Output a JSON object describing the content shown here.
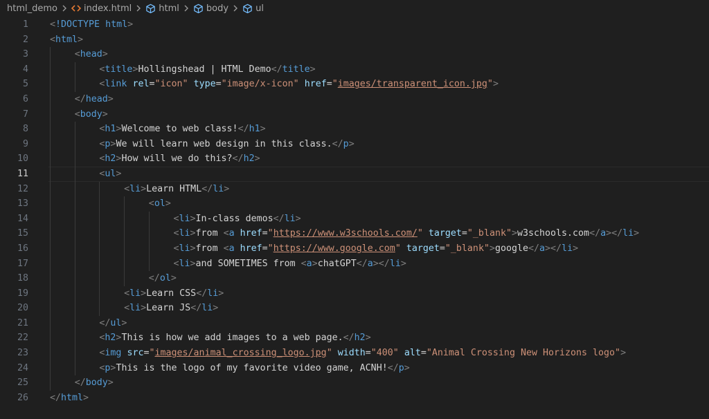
{
  "breadcrumb": {
    "items": [
      {
        "label": "html_demo",
        "icon": "none"
      },
      {
        "label": "index.html",
        "icon": "html-file-icon"
      },
      {
        "label": "html",
        "icon": "symbol-element-icon"
      },
      {
        "label": "body",
        "icon": "symbol-element-icon"
      },
      {
        "label": "ul",
        "icon": "symbol-element-icon"
      }
    ]
  },
  "editor": {
    "current_line": 11,
    "colors": {
      "background": "#1f1f1f",
      "tag": "#569cd6",
      "bracket": "#808080",
      "attribute": "#9cdcfe",
      "string": "#ce9178",
      "text": "#d4d4d4",
      "line_number": "#6e7681"
    },
    "lines": [
      {
        "n": "1",
        "indent": 0,
        "tokens": [
          [
            "p",
            "<"
          ],
          [
            "tag",
            "!DOCTYPE html"
          ],
          [
            "p",
            ">"
          ]
        ]
      },
      {
        "n": "2",
        "indent": 0,
        "tokens": [
          [
            "p",
            "<"
          ],
          [
            "tag",
            "html"
          ],
          [
            "p",
            ">"
          ]
        ]
      },
      {
        "n": "3",
        "indent": 1,
        "tokens": [
          [
            "p",
            "<"
          ],
          [
            "tag",
            "head"
          ],
          [
            "p",
            ">"
          ]
        ]
      },
      {
        "n": "4",
        "indent": 2,
        "tokens": [
          [
            "p",
            "<"
          ],
          [
            "tag",
            "title"
          ],
          [
            "p",
            ">"
          ],
          [
            "txt",
            "Hollingshead | HTML Demo"
          ],
          [
            "p",
            "</"
          ],
          [
            "tag",
            "title"
          ],
          [
            "p",
            ">"
          ]
        ]
      },
      {
        "n": "5",
        "indent": 2,
        "tokens": [
          [
            "p",
            "<"
          ],
          [
            "tag",
            "link"
          ],
          [
            "txt",
            " "
          ],
          [
            "attr",
            "rel"
          ],
          [
            "txt",
            "="
          ],
          [
            "val",
            "\"icon\""
          ],
          [
            "txt",
            " "
          ],
          [
            "attr",
            "type"
          ],
          [
            "txt",
            "="
          ],
          [
            "val",
            "\"image/x-icon\""
          ],
          [
            "txt",
            " "
          ],
          [
            "attr",
            "href"
          ],
          [
            "txt",
            "="
          ],
          [
            "val",
            "\""
          ],
          [
            "url",
            "images/transparent_icon.jpg"
          ],
          [
            "val",
            "\""
          ],
          [
            "p",
            ">"
          ]
        ]
      },
      {
        "n": "6",
        "indent": 1,
        "tokens": [
          [
            "p",
            "</"
          ],
          [
            "tag",
            "head"
          ],
          [
            "p",
            ">"
          ]
        ]
      },
      {
        "n": "7",
        "indent": 1,
        "tokens": [
          [
            "p",
            "<"
          ],
          [
            "tag",
            "body"
          ],
          [
            "p",
            ">"
          ]
        ]
      },
      {
        "n": "8",
        "indent": 2,
        "tokens": [
          [
            "p",
            "<"
          ],
          [
            "tag",
            "h1"
          ],
          [
            "p",
            ">"
          ],
          [
            "txt",
            "Welcome to web class!"
          ],
          [
            "p",
            "</"
          ],
          [
            "tag",
            "h1"
          ],
          [
            "p",
            ">"
          ]
        ]
      },
      {
        "n": "9",
        "indent": 2,
        "tokens": [
          [
            "p",
            "<"
          ],
          [
            "tag",
            "p"
          ],
          [
            "p",
            ">"
          ],
          [
            "txt",
            "We will learn web design in this class."
          ],
          [
            "p",
            "</"
          ],
          [
            "tag",
            "p"
          ],
          [
            "p",
            ">"
          ]
        ]
      },
      {
        "n": "10",
        "indent": 2,
        "tokens": [
          [
            "p",
            "<"
          ],
          [
            "tag",
            "h2"
          ],
          [
            "p",
            ">"
          ],
          [
            "txt",
            "How will we do this?"
          ],
          [
            "p",
            "</"
          ],
          [
            "tag",
            "h2"
          ],
          [
            "p",
            ">"
          ]
        ]
      },
      {
        "n": "11",
        "indent": 2,
        "tokens": [
          [
            "p",
            "<"
          ],
          [
            "tag",
            "ul"
          ],
          [
            "p",
            ">"
          ]
        ]
      },
      {
        "n": "12",
        "indent": 3,
        "tokens": [
          [
            "p",
            "<"
          ],
          [
            "tag",
            "li"
          ],
          [
            "p",
            ">"
          ],
          [
            "txt",
            "Learn HTML"
          ],
          [
            "p",
            "</"
          ],
          [
            "tag",
            "li"
          ],
          [
            "p",
            ">"
          ]
        ]
      },
      {
        "n": "13",
        "indent": 4,
        "tokens": [
          [
            "p",
            "<"
          ],
          [
            "tag",
            "ol"
          ],
          [
            "p",
            ">"
          ]
        ]
      },
      {
        "n": "14",
        "indent": 5,
        "tokens": [
          [
            "p",
            "<"
          ],
          [
            "tag",
            "li"
          ],
          [
            "p",
            ">"
          ],
          [
            "txt",
            "In-class demos"
          ],
          [
            "p",
            "</"
          ],
          [
            "tag",
            "li"
          ],
          [
            "p",
            ">"
          ]
        ]
      },
      {
        "n": "15",
        "indent": 5,
        "tokens": [
          [
            "p",
            "<"
          ],
          [
            "tag",
            "li"
          ],
          [
            "p",
            ">"
          ],
          [
            "txt",
            "from "
          ],
          [
            "p",
            "<"
          ],
          [
            "tag",
            "a"
          ],
          [
            "txt",
            " "
          ],
          [
            "attr",
            "href"
          ],
          [
            "txt",
            "="
          ],
          [
            "val",
            "\""
          ],
          [
            "url",
            "https://www.w3schools.com/"
          ],
          [
            "val",
            "\""
          ],
          [
            "txt",
            " "
          ],
          [
            "attr",
            "target"
          ],
          [
            "txt",
            "="
          ],
          [
            "val",
            "\"_blank\""
          ],
          [
            "p",
            ">"
          ],
          [
            "txt",
            "w3schools.com"
          ],
          [
            "p",
            "</"
          ],
          [
            "tag",
            "a"
          ],
          [
            "p",
            "></"
          ],
          [
            "tag",
            "li"
          ],
          [
            "p",
            ">"
          ]
        ]
      },
      {
        "n": "16",
        "indent": 5,
        "tokens": [
          [
            "p",
            "<"
          ],
          [
            "tag",
            "li"
          ],
          [
            "p",
            ">"
          ],
          [
            "txt",
            "from "
          ],
          [
            "p",
            "<"
          ],
          [
            "tag",
            "a"
          ],
          [
            "txt",
            " "
          ],
          [
            "attr",
            "href"
          ],
          [
            "txt",
            "="
          ],
          [
            "val",
            "\""
          ],
          [
            "url",
            "https://www.google.com"
          ],
          [
            "val",
            "\""
          ],
          [
            "txt",
            " "
          ],
          [
            "attr",
            "target"
          ],
          [
            "txt",
            "="
          ],
          [
            "val",
            "\"_blank\""
          ],
          [
            "p",
            ">"
          ],
          [
            "txt",
            "google"
          ],
          [
            "p",
            "</"
          ],
          [
            "tag",
            "a"
          ],
          [
            "p",
            "></"
          ],
          [
            "tag",
            "li"
          ],
          [
            "p",
            ">"
          ]
        ]
      },
      {
        "n": "17",
        "indent": 5,
        "tokens": [
          [
            "p",
            "<"
          ],
          [
            "tag",
            "li"
          ],
          [
            "p",
            ">"
          ],
          [
            "txt",
            "and SOMETIMES from "
          ],
          [
            "p",
            "<"
          ],
          [
            "tag",
            "a"
          ],
          [
            "p",
            ">"
          ],
          [
            "txt",
            "chatGPT"
          ],
          [
            "p",
            "</"
          ],
          [
            "tag",
            "a"
          ],
          [
            "p",
            "></"
          ],
          [
            "tag",
            "li"
          ],
          [
            "p",
            ">"
          ]
        ]
      },
      {
        "n": "18",
        "indent": 4,
        "tokens": [
          [
            "p",
            "</"
          ],
          [
            "tag",
            "ol"
          ],
          [
            "p",
            ">"
          ]
        ]
      },
      {
        "n": "19",
        "indent": 3,
        "tokens": [
          [
            "p",
            "<"
          ],
          [
            "tag",
            "li"
          ],
          [
            "p",
            ">"
          ],
          [
            "txt",
            "Learn CSS"
          ],
          [
            "p",
            "</"
          ],
          [
            "tag",
            "li"
          ],
          [
            "p",
            ">"
          ]
        ]
      },
      {
        "n": "20",
        "indent": 3,
        "tokens": [
          [
            "p",
            "<"
          ],
          [
            "tag",
            "li"
          ],
          [
            "p",
            ">"
          ],
          [
            "txt",
            "Learn JS"
          ],
          [
            "p",
            "</"
          ],
          [
            "tag",
            "li"
          ],
          [
            "p",
            ">"
          ]
        ]
      },
      {
        "n": "21",
        "indent": 2,
        "tokens": [
          [
            "p",
            "</"
          ],
          [
            "tag",
            "ul"
          ],
          [
            "p",
            ">"
          ]
        ]
      },
      {
        "n": "22",
        "indent": 2,
        "tokens": [
          [
            "p",
            "<"
          ],
          [
            "tag",
            "h2"
          ],
          [
            "p",
            ">"
          ],
          [
            "txt",
            "This is how we add images to a web page."
          ],
          [
            "p",
            "</"
          ],
          [
            "tag",
            "h2"
          ],
          [
            "p",
            ">"
          ]
        ]
      },
      {
        "n": "23",
        "indent": 2,
        "tokens": [
          [
            "p",
            "<"
          ],
          [
            "tag",
            "img"
          ],
          [
            "txt",
            " "
          ],
          [
            "attr",
            "src"
          ],
          [
            "txt",
            "="
          ],
          [
            "val",
            "\""
          ],
          [
            "url",
            "images/animal_crossing_logo.jpg"
          ],
          [
            "val",
            "\""
          ],
          [
            "txt",
            " "
          ],
          [
            "attr",
            "width"
          ],
          [
            "txt",
            "="
          ],
          [
            "val",
            "\"400\""
          ],
          [
            "txt",
            " "
          ],
          [
            "attr",
            "alt"
          ],
          [
            "txt",
            "="
          ],
          [
            "val",
            "\"Animal Crossing New Horizons logo\""
          ],
          [
            "p",
            ">"
          ]
        ]
      },
      {
        "n": "24",
        "indent": 2,
        "tokens": [
          [
            "p",
            "<"
          ],
          [
            "tag",
            "p"
          ],
          [
            "p",
            ">"
          ],
          [
            "txt",
            "This is the logo of my favorite video game, ACNH!"
          ],
          [
            "p",
            "</"
          ],
          [
            "tag",
            "p"
          ],
          [
            "p",
            ">"
          ]
        ]
      },
      {
        "n": "25",
        "indent": 1,
        "tokens": [
          [
            "p",
            "</"
          ],
          [
            "tag",
            "body"
          ],
          [
            "p",
            ">"
          ]
        ]
      },
      {
        "n": "26",
        "indent": 0,
        "tokens": [
          [
            "p",
            "</"
          ],
          [
            "tag",
            "html"
          ],
          [
            "p",
            ">"
          ]
        ]
      }
    ]
  }
}
